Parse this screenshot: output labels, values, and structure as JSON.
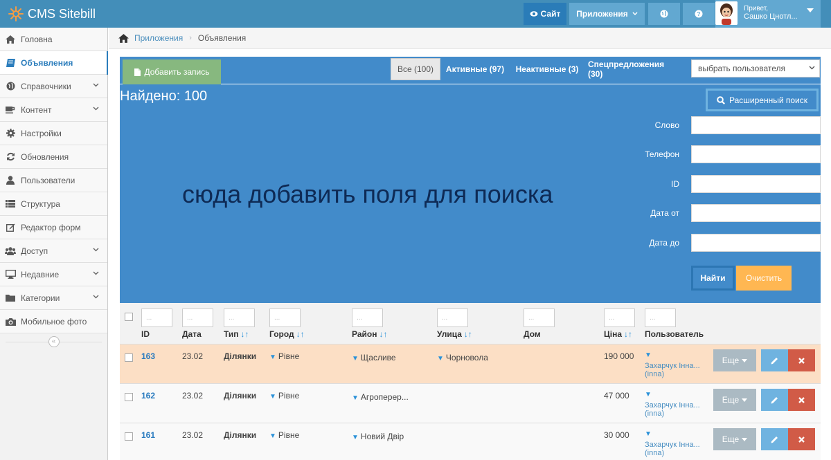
{
  "app": {
    "title": "CMS Sitebill"
  },
  "topnav": {
    "site_label": "Сайт",
    "apps_label": "Приложения",
    "greeting": "Привет,",
    "user_name": "Сашко Цнотл..."
  },
  "sidebar": {
    "items": [
      {
        "label": "Головна",
        "icon": "home-icon"
      },
      {
        "label": "Объявления",
        "icon": "book-icon"
      },
      {
        "label": "Справочники",
        "icon": "globe-icon"
      },
      {
        "label": "Контент",
        "icon": "coffee-icon"
      },
      {
        "label": "Настройки",
        "icon": "gear-icon"
      },
      {
        "label": "Обновления",
        "icon": "refresh-icon"
      },
      {
        "label": "Пользователи",
        "icon": "user-icon"
      },
      {
        "label": "Структура",
        "icon": "list-icon"
      },
      {
        "label": "Редактор форм",
        "icon": "edit-icon"
      },
      {
        "label": "Доступ",
        "icon": "group-icon"
      },
      {
        "label": "Недавние",
        "icon": "desktop-icon"
      },
      {
        "label": "Категории",
        "icon": "folder-icon"
      },
      {
        "label": "Мобильное фото",
        "icon": "camera-icon"
      }
    ],
    "collapse_glyph": "«"
  },
  "breadcrumbs": {
    "link": "Приложения",
    "current": "Объявления"
  },
  "panel": {
    "add_label": "Добавить запись",
    "tabs": [
      {
        "label": "Все (100)"
      },
      {
        "label": "Активные (97)"
      },
      {
        "label": "Неактивные (3)"
      },
      {
        "label": "Спецпредложения (30)"
      }
    ],
    "user_select": "выбрать пользователя",
    "found": "Найдено: 100",
    "advanced_search": "Расширенный поиск",
    "placeholder_message": "сюда добавить поля для поиска",
    "fields": [
      {
        "label": "Слово"
      },
      {
        "label": "Телефон"
      },
      {
        "label": "ID"
      },
      {
        "label": "Дата от"
      },
      {
        "label": "Дата до"
      }
    ],
    "find_label": "Найти",
    "clear_label": "Очистить"
  },
  "table": {
    "filter_placeholder": "...",
    "columns": [
      {
        "label": "ID",
        "sort": ""
      },
      {
        "label": "Дата",
        "sort": ""
      },
      {
        "label": "Тип",
        "sort": "↓↑"
      },
      {
        "label": "Город",
        "sort": "↓↑"
      },
      {
        "label": "Район",
        "sort": "↓↑"
      },
      {
        "label": "Улица",
        "sort": "↓↑"
      },
      {
        "label": "Дом",
        "sort": ""
      },
      {
        "label": "Ціна",
        "sort": "↓↑"
      },
      {
        "label": "Пользователь",
        "sort": ""
      }
    ],
    "rows": [
      {
        "id": "163",
        "date": "23.02",
        "type": "Ділянки",
        "city": "Рівне",
        "district": "Щасливе",
        "street": "Чорновола",
        "house": "",
        "price": "190 000",
        "user": "Захарчук Інна...",
        "login": "(inna)"
      },
      {
        "id": "162",
        "date": "23.02",
        "type": "Ділянки",
        "city": "Рівне",
        "district": "Агроперер...",
        "street": "",
        "house": "",
        "price": "47 000",
        "user": "Захарчук Інна...",
        "login": "(inna)"
      },
      {
        "id": "161",
        "date": "23.02",
        "type": "Ділянки",
        "city": "Рівне",
        "district": "Новий Двір",
        "street": "",
        "house": "",
        "price": "30 000",
        "user": "Захарчук Інна...",
        "login": "(inna)"
      }
    ],
    "more_label": "Еще"
  },
  "colors": {
    "navbar": "#438eb9",
    "panel": "#428bca",
    "add_button": "#87b87f",
    "clear_button": "#ffb752",
    "delete_button": "#d15b47",
    "highlight_row": "#fcdfc5"
  }
}
